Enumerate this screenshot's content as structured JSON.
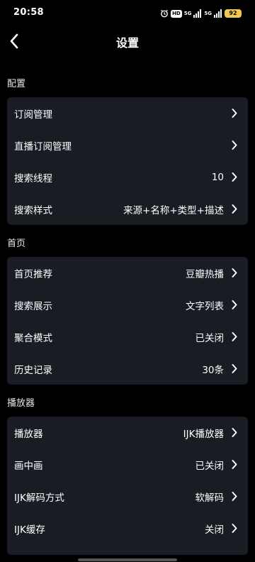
{
  "status_bar": {
    "time": "20:58",
    "hd_badge": "HD",
    "network_1": "5G",
    "network_2": "5G",
    "battery": "92",
    "battery_color": "#f2c94c"
  },
  "header": {
    "title": "设置",
    "back_icon": "chevron-left-icon"
  },
  "sections": [
    {
      "title": "配置",
      "rows": [
        {
          "label": "订阅管理",
          "value": ""
        },
        {
          "label": "直播订阅管理",
          "value": ""
        },
        {
          "label": "搜索线程",
          "value": "10"
        },
        {
          "label": "搜索样式",
          "value": "来源+名称+类型+描述"
        }
      ]
    },
    {
      "title": "首页",
      "rows": [
        {
          "label": "首页推荐",
          "value": "豆瓣热播"
        },
        {
          "label": "搜索展示",
          "value": "文字列表"
        },
        {
          "label": "聚合模式",
          "value": "已关闭"
        },
        {
          "label": "历史记录",
          "value": "30条"
        }
      ]
    },
    {
      "title": "播放器",
      "rows": [
        {
          "label": "播放器",
          "value": "IJK播放器"
        },
        {
          "label": "画中画",
          "value": "已关闭"
        },
        {
          "label": "IJK解码方式",
          "value": "软解码"
        },
        {
          "label": "IJK缓存",
          "value": "关闭"
        }
      ]
    }
  ],
  "colors": {
    "background": "#000000",
    "card": "#1a1c24",
    "text": "#ffffff"
  }
}
